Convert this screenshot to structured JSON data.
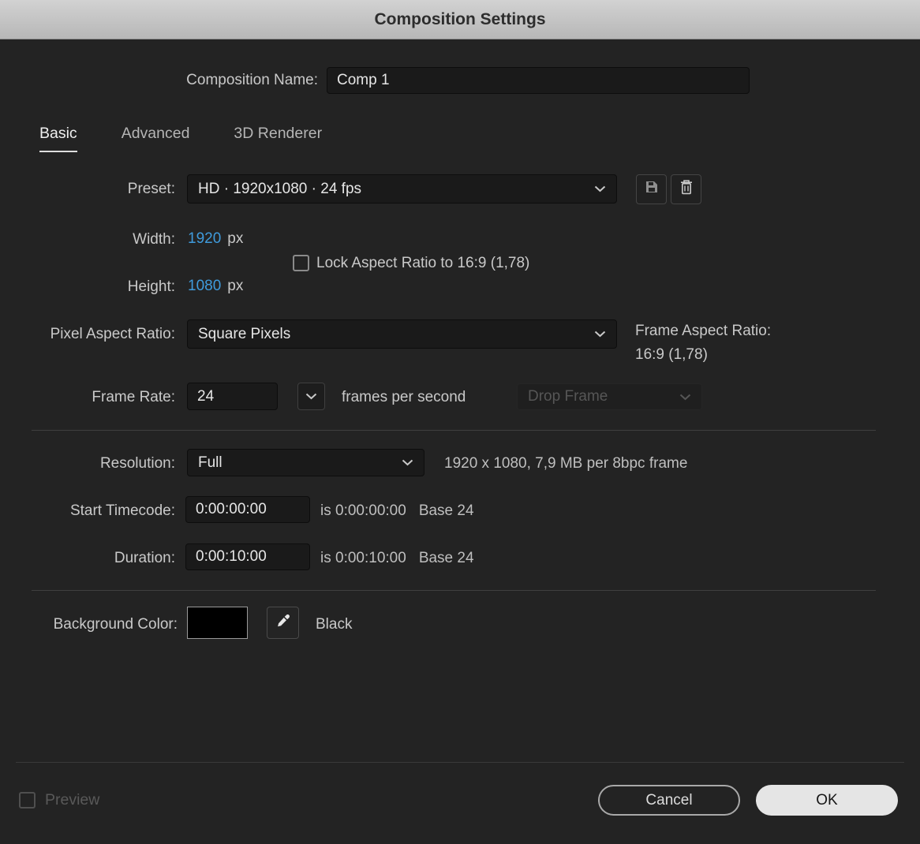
{
  "colors": {
    "value_blue": "#3f9bdc",
    "background_swatch": "#000000"
  },
  "dialog": {
    "title": "Composition Settings",
    "composition_name_label": "Composition Name:",
    "composition_name_value": "Comp 1"
  },
  "tabs": [
    {
      "label": "Basic"
    },
    {
      "label": "Advanced"
    },
    {
      "label": "3D Renderer"
    }
  ],
  "basic": {
    "preset_label": "Preset:",
    "preset_value": "HD · 1920x1080 · 24 fps",
    "width_label": "Width:",
    "width_value": "1920",
    "width_unit": "px",
    "height_label": "Height:",
    "height_value": "1080",
    "height_unit": "px",
    "lock_aspect_label": "Lock Aspect Ratio to 16:9 (1,78)",
    "pixel_aspect_label": "Pixel Aspect Ratio:",
    "pixel_aspect_value": "Square Pixels",
    "frame_aspect_label": "Frame Aspect Ratio:",
    "frame_aspect_value": "16:9 (1,78)",
    "frame_rate_label": "Frame Rate:",
    "frame_rate_value": "24",
    "frames_per_second_label": "frames per second",
    "drop_frame_value": "Drop Frame",
    "resolution_label": "Resolution:",
    "resolution_value": "Full",
    "resolution_info": "1920 x 1080, 7,9 MB per 8bpc frame",
    "start_timecode_label": "Start Timecode:",
    "start_timecode_value": "0:00:00:00",
    "start_timecode_info": "is 0:00:00:00",
    "start_timecode_base": "Base 24",
    "duration_label": "Duration:",
    "duration_value": "0:00:10:00",
    "duration_info": "is 0:00:10:00",
    "duration_base": "Base 24",
    "background_color_label": "Background Color:",
    "background_color_name": "Black"
  },
  "footer": {
    "preview_label": "Preview",
    "cancel_label": "Cancel",
    "ok_label": "OK"
  }
}
